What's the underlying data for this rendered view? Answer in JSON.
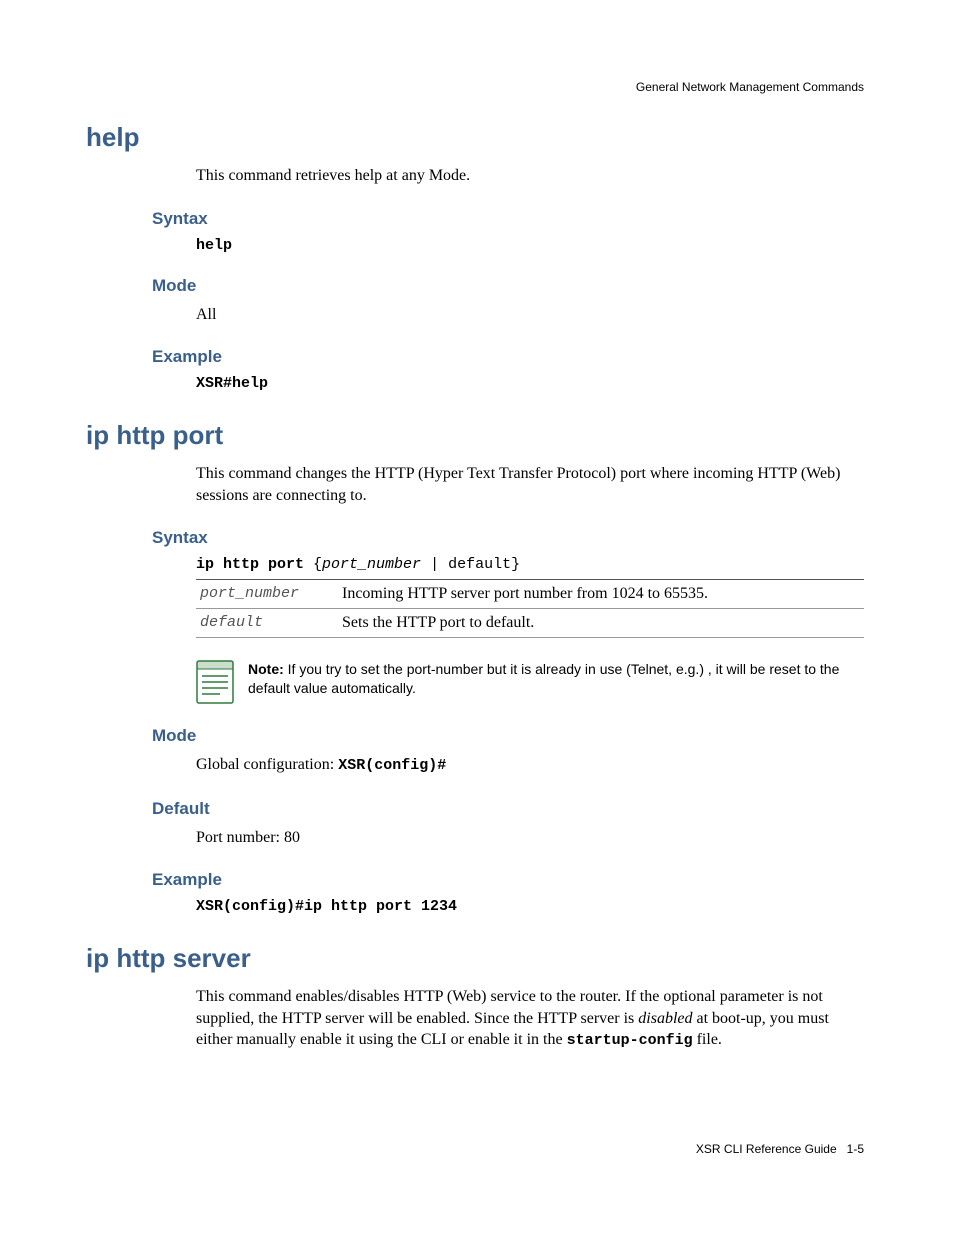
{
  "header": {
    "section_path": "General Network Management Commands"
  },
  "sections": {
    "help": {
      "title": "help",
      "description": "This command retrieves help at any Mode.",
      "syntax_label": "Syntax",
      "syntax_value": "help",
      "mode_label": "Mode",
      "mode_value": "All",
      "example_label": "Example",
      "example_value": "XSR#help"
    },
    "ip_http_port": {
      "title": "ip http port",
      "description": "This command changes the HTTP (Hyper Text Transfer Protocol) port where incoming HTTP (Web) sessions are connecting to.",
      "syntax_label": "Syntax",
      "syntax_cmd_bold": "ip http port ",
      "syntax_cmd_rest_open": "{",
      "syntax_cmd_param": "port_number",
      "syntax_cmd_rest_close": " | default}",
      "params": [
        {
          "key": "port_number",
          "desc": "Incoming HTTP server port number from 1024 to 65535."
        },
        {
          "key": "default",
          "desc": "Sets the HTTP port to default."
        }
      ],
      "note_label": "Note:",
      "note_text": " If you try to set the port-number but it is already in use (Telnet, e.g.) , it will be reset to the default value automatically.",
      "mode_label": "Mode",
      "mode_prefix": "Global configuration: ",
      "mode_code": "XSR(config)#",
      "default_label": "Default",
      "default_value": "Port number: 80",
      "example_label": "Example",
      "example_value": "XSR(config)#ip http port 1234"
    },
    "ip_http_server": {
      "title": "ip http server",
      "desc_part1": "This command enables/disables HTTP (Web) service to the router. If the optional parameter is not supplied, the HTTP server will be enabled. Since the HTTP server is ",
      "desc_italic": "disabled",
      "desc_part2": " at boot‑up, you must either manually enable it using the CLI or enable it in the ",
      "desc_code": "startup-config",
      "desc_part3": " file."
    }
  },
  "footer": {
    "doc_title": "XSR CLI Reference Guide",
    "page": "1-5"
  }
}
